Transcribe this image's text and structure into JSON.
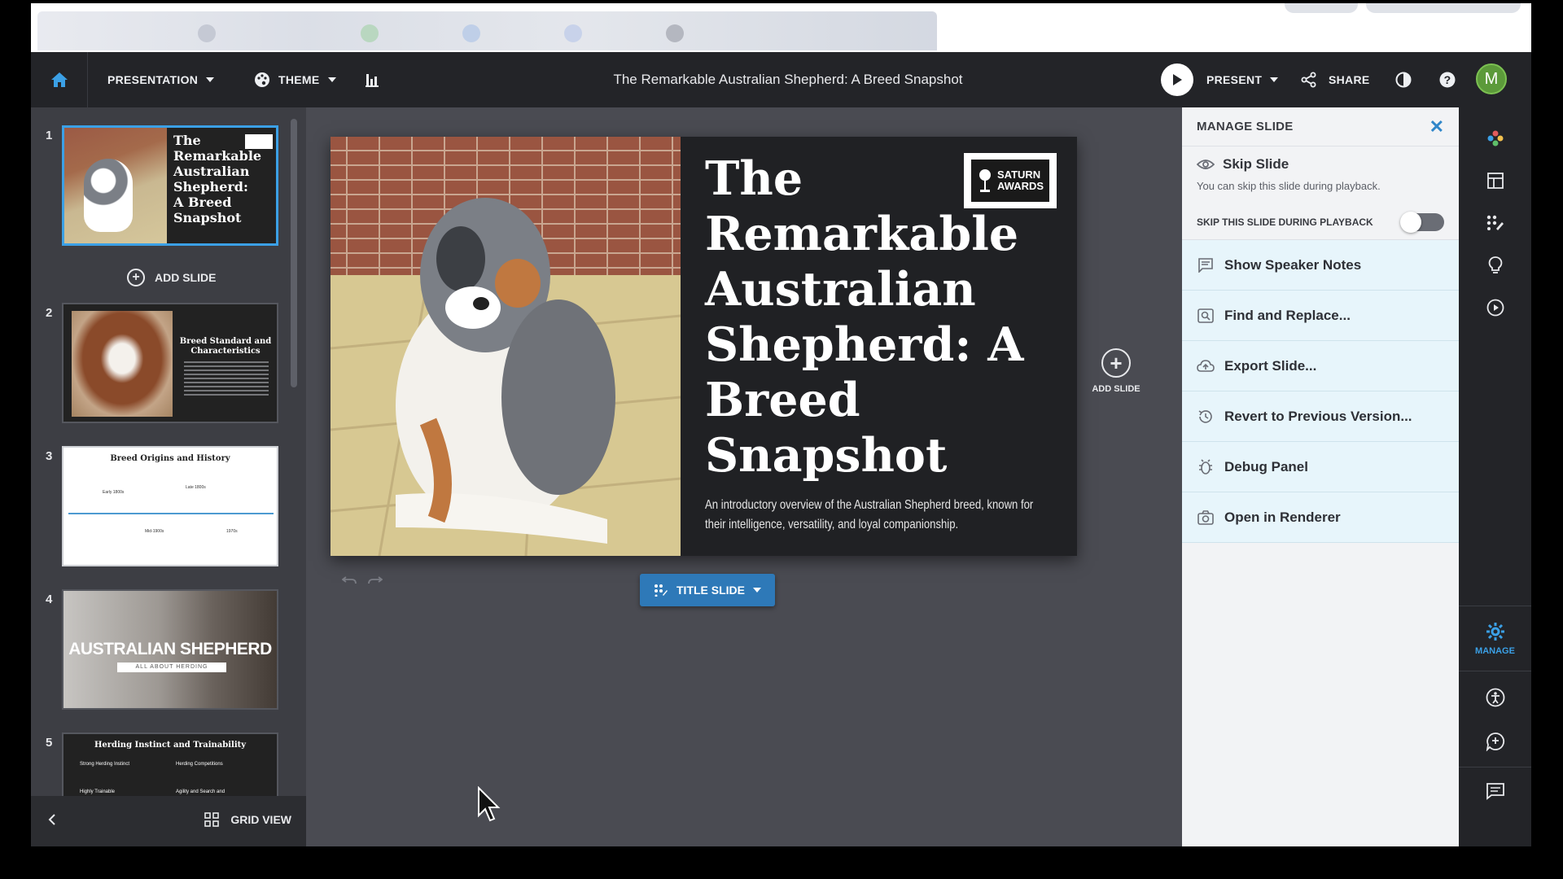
{
  "toolbar": {
    "presentation_label": "PRESENTATION",
    "theme_label": "THEME",
    "doc_title": "The Remarkable Australian Shepherd: A Breed Snapshot",
    "present_label": "PRESENT",
    "share_label": "SHARE",
    "avatar_initial": "M"
  },
  "slides_panel": {
    "add_slide_label": "ADD SLIDE",
    "grid_view_label": "GRID VIEW",
    "thumbs": [
      {
        "num": "1",
        "title": "The Remarkable Australian Shepherd: A Breed Snapshot"
      },
      {
        "num": "2",
        "title": "Breed Standard and Characteristics"
      },
      {
        "num": "3",
        "title": "Breed Origins and History"
      },
      {
        "num": "4",
        "title": "AUSTRALIAN SHEPHERD",
        "subtitle": "ALL ABOUT HERDING"
      },
      {
        "num": "5",
        "title": "Herding Instinct and Trainability",
        "bullets": [
          "Strong Herding Instinct",
          "Herding Competitions",
          "Highly Trainable",
          "Agility and Search and"
        ]
      }
    ],
    "timeline": [
      "Early 1800s",
      "Late 1800s",
      "Mid-1900s",
      "1970s"
    ]
  },
  "slide": {
    "title": "The Remarkable Australian Shepherd: A Breed Snapshot",
    "subtitle": "An introductory overview of the Australian Shepherd breed, known for their intelligence, versatility, and loyal companionship.",
    "logo_text_1": "SATURN",
    "logo_text_2": "AWARDS",
    "layout_label": "TITLE SLIDE",
    "add_slide_label": "ADD SLIDE"
  },
  "manage_panel": {
    "header": "MANAGE SLIDE",
    "skip_title": "Skip Slide",
    "skip_desc": "You can skip this slide during playback.",
    "skip_toggle_label": "SKIP THIS SLIDE DURING PLAYBACK",
    "skip_enabled": false,
    "items": [
      {
        "label": "Show Speaker Notes",
        "icon": "speaker-notes-icon"
      },
      {
        "label": "Find and Replace...",
        "icon": "find-replace-icon"
      },
      {
        "label": "Export Slide...",
        "icon": "cloud-export-icon"
      },
      {
        "label": "Revert to Previous Version...",
        "icon": "history-icon"
      },
      {
        "label": "Debug Panel",
        "icon": "bug-icon"
      },
      {
        "label": "Open in Renderer",
        "icon": "camera-icon"
      }
    ]
  },
  "rail": {
    "manage_label": "MANAGE"
  },
  "colors": {
    "accent": "#3ba0e6",
    "toolbar_bg": "#232428",
    "panel_item_bg": "#e7f5fb",
    "layout_button": "#2e79b8"
  }
}
